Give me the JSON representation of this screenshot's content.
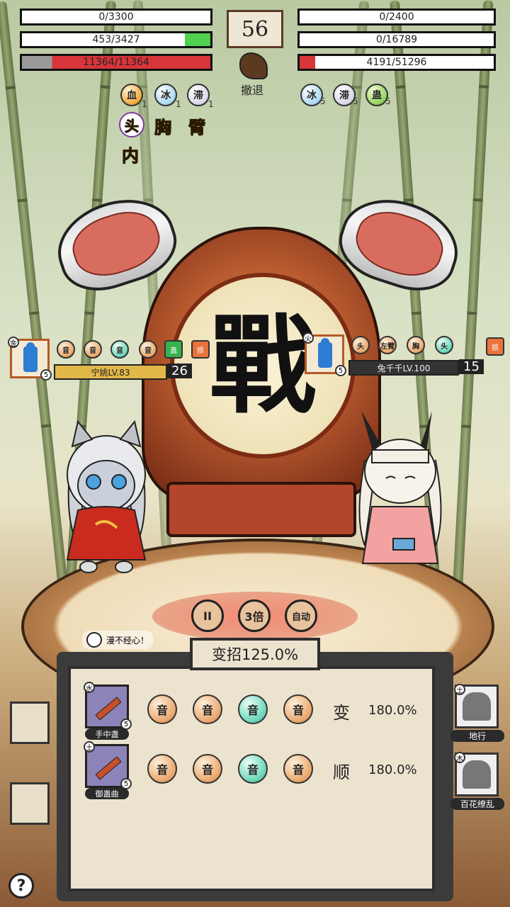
{
  "player": {
    "bar1": "0/3300",
    "bar2": "453/3427",
    "hp": "11364/11364",
    "name_level": "宁姚LV.83",
    "level_value": "26",
    "element": "金",
    "portrait_badge": "5",
    "statuses": [
      {
        "glyph": "血",
        "count": "1"
      },
      {
        "glyph": "冰",
        "count": "1"
      },
      {
        "glyph": "滞",
        "count": "1"
      }
    ],
    "injuries": [
      "头",
      "胸",
      "臂",
      "内"
    ],
    "small_orbs": [
      "音",
      "音",
      "音",
      "音"
    ],
    "buffs": [
      "蛊",
      "损"
    ]
  },
  "enemy": {
    "bar1": "0/2400",
    "bar2": "0/16789",
    "hp": "4191/51296",
    "name_level": "兔千千LV.100",
    "level_value": "15",
    "element": "火",
    "portrait_badge": "5",
    "statuses": [
      {
        "glyph": "冰",
        "count": "5"
      },
      {
        "glyph": "滞",
        "count": "5"
      },
      {
        "glyph": "蛊",
        "count": "5"
      }
    ],
    "small_orbs": [
      "头",
      "左臂",
      "胸",
      "头"
    ],
    "buffs": [
      "损"
    ]
  },
  "timer": "56",
  "retreat_label": "撤退",
  "drum_char": "戰",
  "controls": {
    "pause": "II",
    "speed": "3倍",
    "auto": "自动"
  },
  "hint_text": "漫不经心！",
  "panel": {
    "title": "变招125.0%",
    "rows": [
      {
        "skill": "手中盏",
        "element": "水",
        "badge": "5",
        "orbs": [
          "音",
          "音",
          "音",
          "音"
        ],
        "word": "变",
        "percent": "180.0%"
      },
      {
        "skill": "御蛊曲",
        "element": "土",
        "badge": "5",
        "orbs": [
          "音",
          "音",
          "音",
          "音"
        ],
        "word": "顺",
        "percent": "180.0%"
      }
    ]
  },
  "right_skills": [
    {
      "label": "地行",
      "element": "土"
    },
    {
      "label": "百花缭乱",
      "element": "木"
    }
  ],
  "help_label": "?"
}
